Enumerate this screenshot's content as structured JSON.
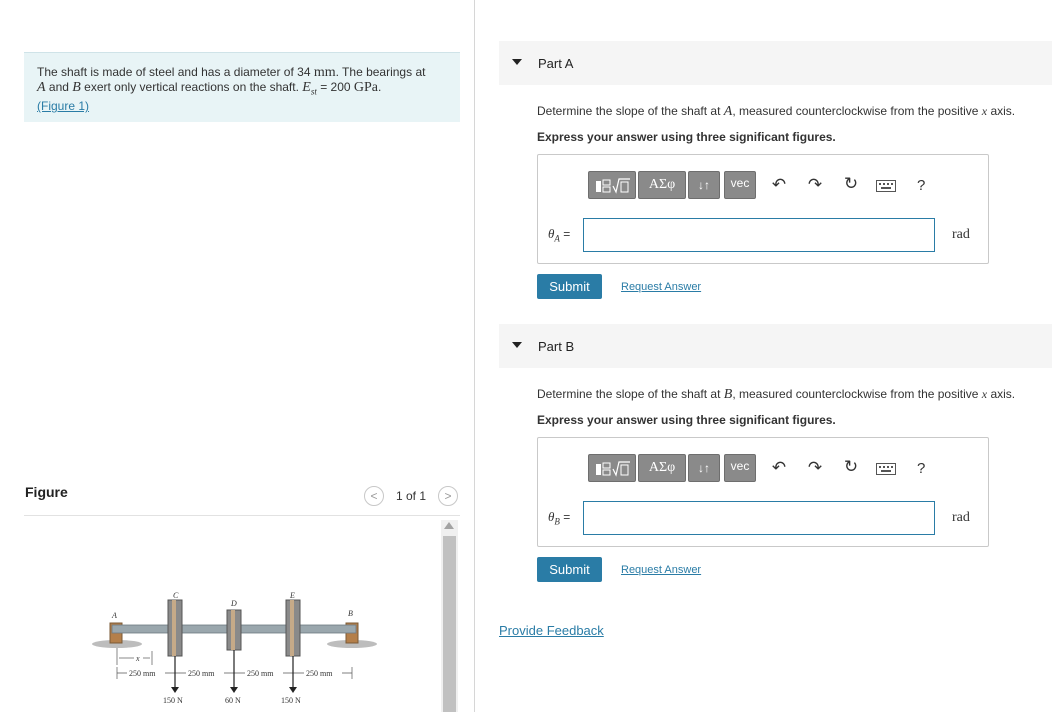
{
  "problem": {
    "text_1": "The shaft is made of steel and has a diameter of 34 ",
    "unit_mm": "mm",
    "text_2": ". The bearings at",
    "var_a": "A",
    "text_3": " and ",
    "var_b": "B",
    "text_4": " exert only vertical reactions on the shaft. ",
    "var_e": "E",
    "sub_st": "st",
    "text_5": " = 200 ",
    "unit_gpa": "GPa",
    "text_6": ".",
    "figure_link": "(Figure 1)"
  },
  "figure": {
    "heading": "Figure",
    "pager_text": "1 of 1",
    "prev_icon": "chevron-left-icon",
    "next_icon": "chevron-right-icon",
    "labels": {
      "a": "A",
      "b": "B",
      "c": "C",
      "d": "D",
      "e": "E",
      "x": "x",
      "dim1": "250 mm",
      "dim2": "250 mm",
      "dim3": "250 mm",
      "dim4": "250 mm",
      "load_c": "150 N",
      "load_d": "60 N",
      "load_e": "150 N"
    }
  },
  "toolbar": {
    "templates_icon": "fraction-sqrt-icon",
    "greek": "ΑΣφ",
    "arrows": "↓↑",
    "vec": "vec",
    "undo_icon": "undo-icon",
    "redo_icon": "redo-icon",
    "reset_icon": "reset-icon",
    "keyboard_icon": "keyboard-icon",
    "help": "?"
  },
  "parts": [
    {
      "title": "Part A",
      "prompt_pre": "Determine the slope of the shaft at ",
      "prompt_point": "A",
      "prompt_post": ", measured counterclockwise from the positive ",
      "prompt_axis": "x",
      "prompt_end": " axis.",
      "instruction": "Express your answer using three significant figures.",
      "var_symbol": "θ",
      "var_sub": "A",
      "equals": "=",
      "input_value": "",
      "unit": "rad",
      "submit": "Submit",
      "request": "Request Answer"
    },
    {
      "title": "Part B",
      "prompt_pre": "Determine the slope of the shaft at ",
      "prompt_point": "B",
      "prompt_post": ", measured counterclockwise from the positive ",
      "prompt_axis": "x",
      "prompt_end": " axis.",
      "instruction": "Express your answer using three significant figures.",
      "var_symbol": "θ",
      "var_sub": "B",
      "equals": "=",
      "input_value": "",
      "unit": "rad",
      "submit": "Submit",
      "request": "Request Answer"
    }
  ],
  "feedback_link": "Provide Feedback",
  "colors": {
    "accent": "#2a7ca6",
    "problem_bg": "#e8f4f6",
    "toolbar_btn": "#8a8a8a",
    "part_header_bg": "#f5f5f5"
  }
}
